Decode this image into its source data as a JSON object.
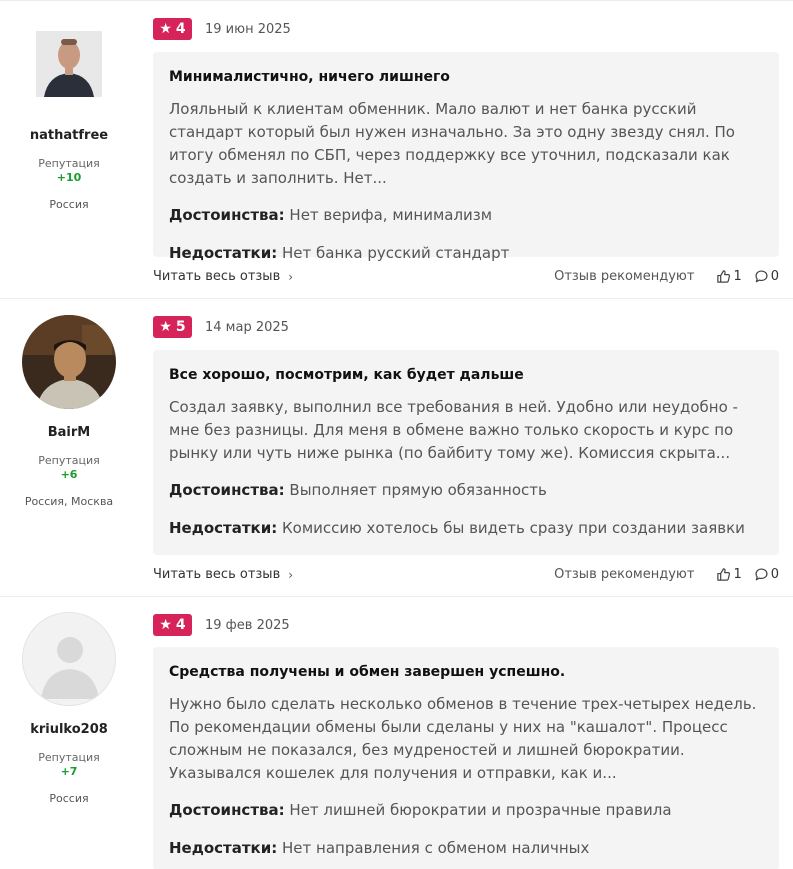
{
  "reviews": [
    {
      "author": {
        "name": "nathatfree",
        "reputation_label": "Репутация",
        "reputation": "+10",
        "location": "Россия"
      },
      "rating": "4",
      "date": "19 июн 2025",
      "title": "Минималистично, ничего лишнего",
      "text": "Лояльный к клиентам обменник. Мало валют и нет банка русский стандарт который был нужен изначально. За это одну звезду снял. По итогу обменял по СБП, через поддержку все уточнил, подсказали как создать и заполнить. Нет...",
      "pros_label": "Достоинства:",
      "pros": "Нет верифа, минимализм",
      "cons_label": "Недостатки:",
      "cons": "Нет банка русский стандарт",
      "read_more": "Читать весь отзыв",
      "recommend_label": "Отзыв рекомендуют",
      "likes": "1",
      "comments": "0"
    },
    {
      "author": {
        "name": "BairM",
        "reputation_label": "Репутация",
        "reputation": "+6",
        "location": "Россия, Москва"
      },
      "rating": "5",
      "date": "14 мар 2025",
      "title": "Все хорошо, посмотрим, как будет дальше",
      "text": "Создал заявку, выполнил все требования в ней. Удобно или неудобно - мне без разницы. Для меня в обмене важно только скорость и курс по рынку или чуть ниже рынка (по байбиту тому же). Комиссия скрыта...",
      "pros_label": "Достоинства:",
      "pros": "Выполняет прямую обязанность",
      "cons_label": "Недостатки:",
      "cons": "Комиссию хотелось бы видеть сразу при создании заявки",
      "read_more": "Читать весь отзыв",
      "recommend_label": "Отзыв рекомендуют",
      "likes": "1",
      "comments": "0"
    },
    {
      "author": {
        "name": "kriulko208",
        "reputation_label": "Репутация",
        "reputation": "+7",
        "location": "Россия"
      },
      "rating": "4",
      "date": "19 фев 2025",
      "title": "Средства получены и обмен завершен успешно.",
      "text": "Нужно было сделать несколько обменов в течение трех-четырех недель. По рекомендации обмены были сделаны у них на \"кашалот\". Процесс сложным не показался, без мудреностей и лишней бюрократии. Указывался кошелек для получения и отправки, как и...",
      "pros_label": "Достоинства:",
      "pros": "Нет лишней бюрократии и прозрачные правила",
      "cons_label": "Недостатки:",
      "cons": "Нет направления с обменом наличных"
    }
  ],
  "colors": {
    "rating_badge": "#d6245b",
    "reputation": "#1a9c2e",
    "card_bg": "#f4f4f4"
  },
  "icons": {
    "star": "star-icon",
    "chevron": "chevron-right-icon",
    "like": "thumbs-up-icon",
    "comment": "comment-icon"
  }
}
